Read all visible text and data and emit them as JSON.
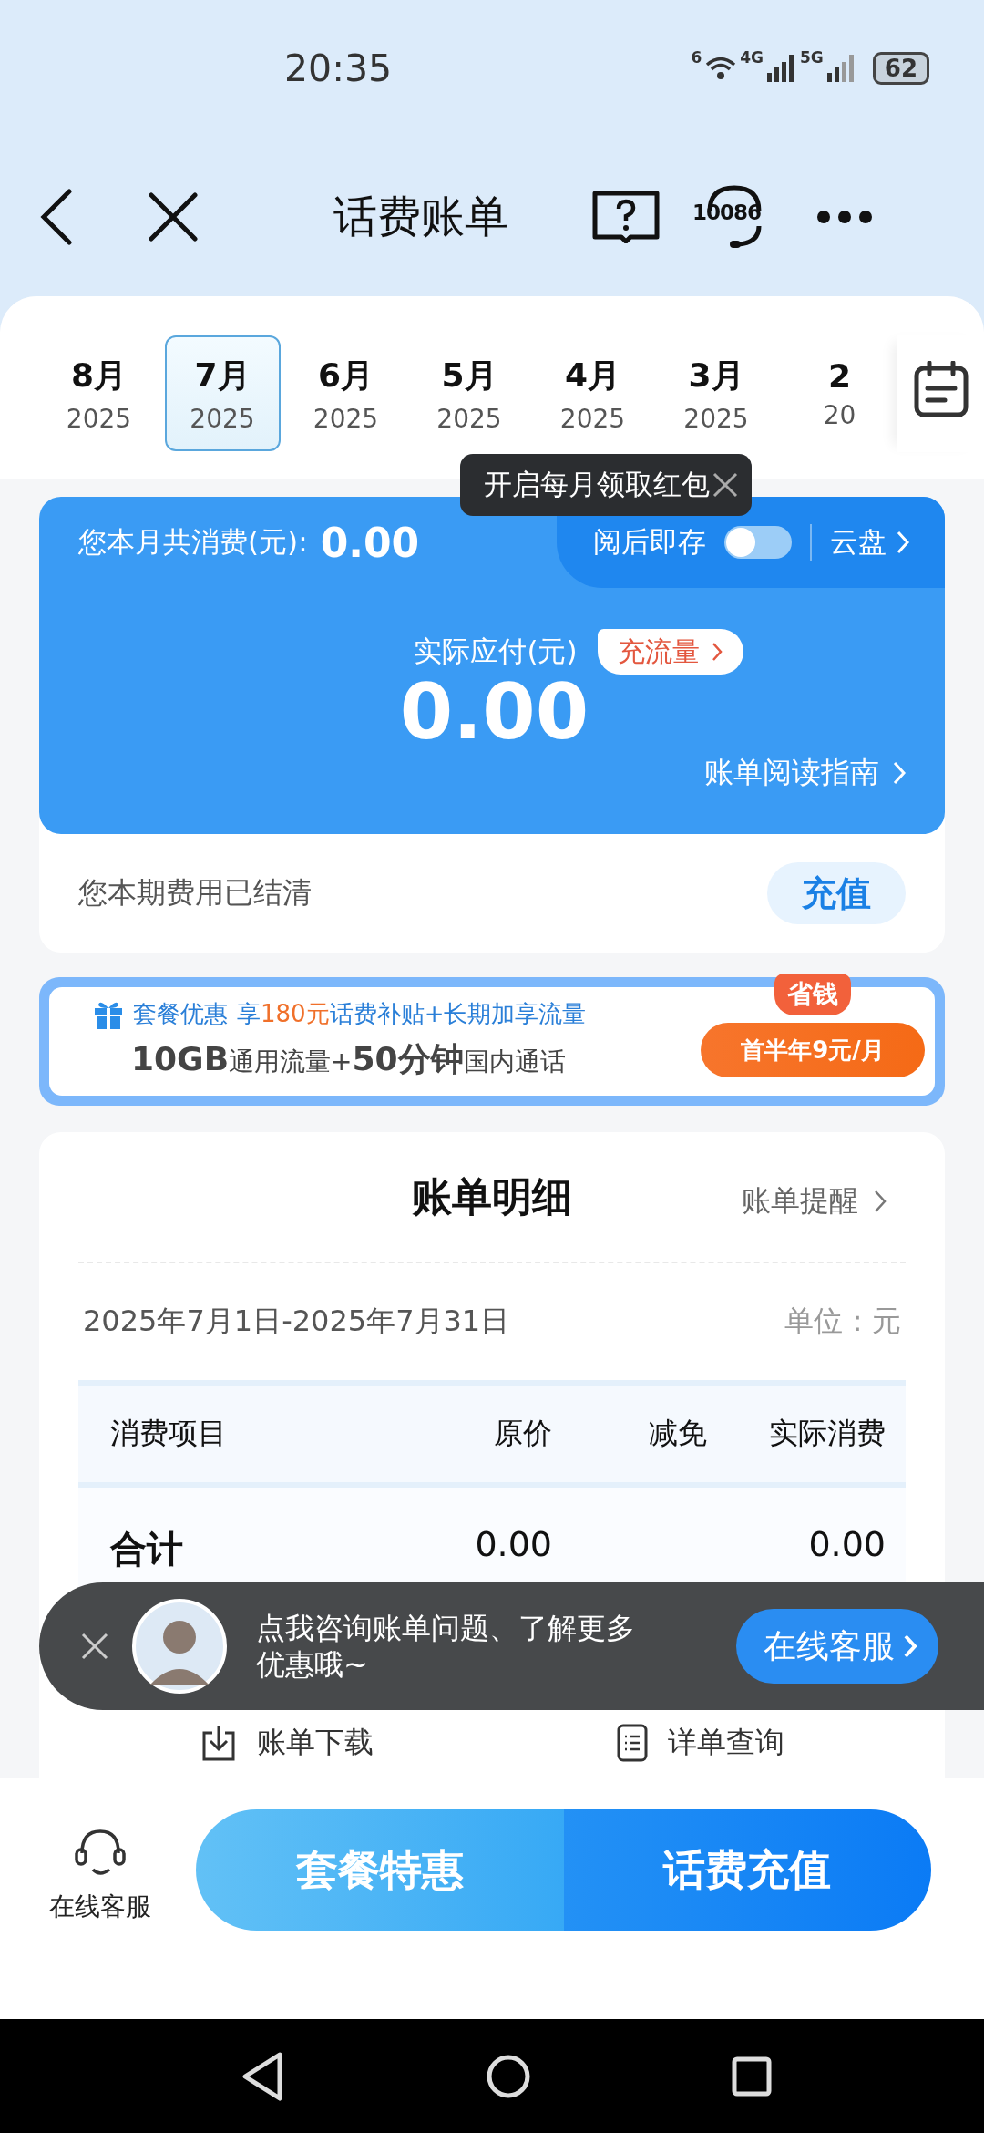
{
  "status_bar": {
    "time": "20:35",
    "wifi_badge": "6",
    "network_1": "4G",
    "network_2": "5G",
    "battery": "62"
  },
  "nav": {
    "title": "话费账单",
    "hotline": "10086"
  },
  "months": [
    {
      "month": "8月",
      "year": "2025",
      "selected": false
    },
    {
      "month": "7月",
      "year": "2025",
      "selected": true
    },
    {
      "month": "6月",
      "year": "2025",
      "selected": false
    },
    {
      "month": "5月",
      "year": "2025",
      "selected": false
    },
    {
      "month": "4月",
      "year": "2025",
      "selected": false
    },
    {
      "month": "3月",
      "year": "2025",
      "selected": false
    },
    {
      "month": "2",
      "year": "20",
      "selected": false
    }
  ],
  "tooltip": {
    "text": "开启每月领取红包"
  },
  "summary": {
    "label": "您本月共消费(元):",
    "total": "0.00",
    "save_label": "阅后即存",
    "save_on": false,
    "cloud": "云盘",
    "due_label": "实际应付(元)",
    "due": "0.00",
    "data_button": "充流量",
    "guide": "账单阅读指南",
    "status": "您本期费用已结清",
    "recharge": "充值"
  },
  "promo": {
    "tag": "套餐优惠",
    "offer_prefix": "享",
    "offer_amount": "180元",
    "offer_suffix": "话费补贴+长期加享流量",
    "line2": "**10GB**通用流量+**50分钟**国内通话",
    "badge": "省钱",
    "button": "首半年9元/月"
  },
  "detail": {
    "title": "账单明细",
    "reminder": "账单提醒",
    "period": "2025年7月1日-2025年7月31日",
    "unit": "单位：元",
    "columns": [
      "消费项目",
      "原价",
      "减免",
      "实际消费"
    ],
    "rows": [
      {
        "item": "合计",
        "original": "0.00",
        "actual": "0.00"
      }
    ]
  },
  "actions": [
    {
      "kind": "download",
      "label": "账单下载"
    },
    {
      "kind": "list",
      "label": "详单查询"
    }
  ],
  "chat": {
    "message": "点我咨询账单问题、了解更多优惠哦~",
    "button": "在线客服"
  },
  "bottom": {
    "service_label": "在线客服",
    "buttons": [
      {
        "kind": "offer",
        "label": "套餐特惠"
      },
      {
        "kind": "recharge",
        "label": "话费充值"
      }
    ]
  }
}
